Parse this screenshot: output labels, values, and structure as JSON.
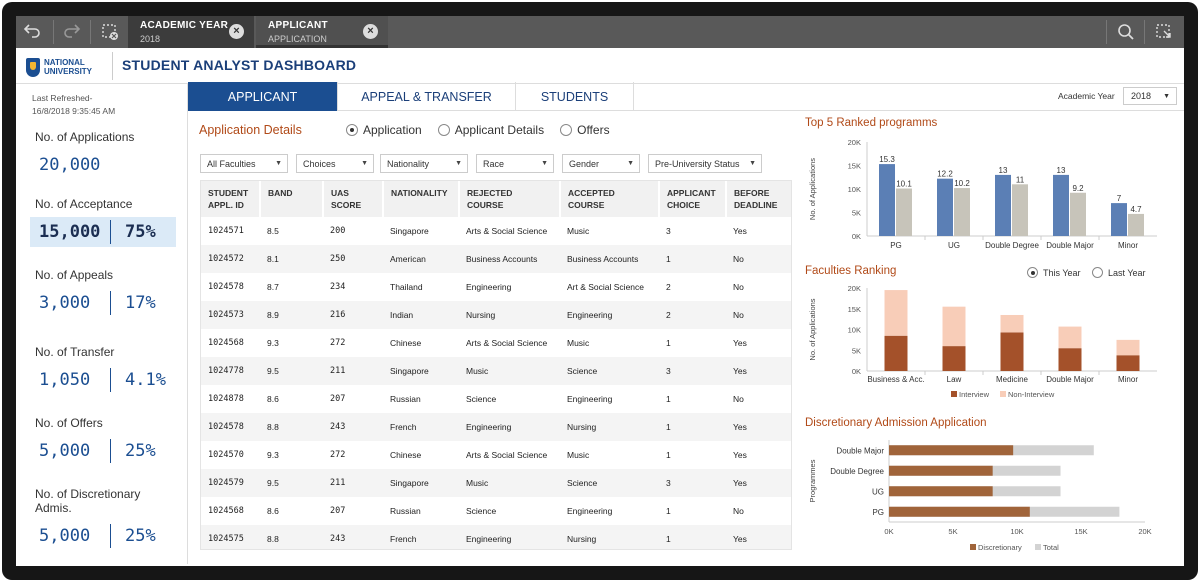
{
  "selections": {
    "chip1": {
      "title": "ACADEMIC YEAR",
      "value": "2018"
    },
    "chip2": {
      "title": "APPLICANT",
      "value": "APPLICATION"
    }
  },
  "header": {
    "logo_line1": "NATIONAL",
    "logo_line2": "UNIVERSITY",
    "title": "STUDENT ANALYST DASHBOARD"
  },
  "sidebar": {
    "refresh_label": "Last Refreshed-",
    "refresh_time": "16/8/2018 9:35:45 AM",
    "kpis": [
      {
        "label": "No. of Applications",
        "value": "20,000",
        "pct": ""
      },
      {
        "label": "No. of Acceptance",
        "value": "15,000",
        "pct": "75%"
      },
      {
        "label": "No. of Appeals",
        "value": "3,000",
        "pct": "17%"
      },
      {
        "label": "No. of Transfer",
        "value": "1,050",
        "pct": "4.1%"
      },
      {
        "label": "No. of Offers",
        "value": "5,000",
        "pct": "25%"
      },
      {
        "label": "No. of Discretionary Admis.",
        "value": "5,000",
        "pct": "25%"
      }
    ]
  },
  "tabs": [
    {
      "label": "APPLICANT",
      "active": true
    },
    {
      "label": "APPEAL & TRANSFER",
      "active": false
    },
    {
      "label": "STUDENTS",
      "active": false
    }
  ],
  "academic_year": {
    "label": "Academic Year",
    "value": "2018"
  },
  "details": {
    "title": "Application Details",
    "radios": [
      "Application",
      "Applicant Details",
      "Offers"
    ],
    "selected_radio": "Application",
    "filters": [
      "All Faculties",
      "Choices",
      "Nationality",
      "Race",
      "Gender",
      "Pre-University Status"
    ]
  },
  "table": {
    "headers": [
      [
        "STUDENT",
        "APPL. ID"
      ],
      [
        "BAND",
        ""
      ],
      [
        "UAS",
        "SCORE"
      ],
      [
        "NATIONALITY",
        ""
      ],
      [
        "REJECTED",
        "COURSE"
      ],
      [
        "ACCEPTED",
        "COURSE"
      ],
      [
        "APPLICANT",
        "CHOICE"
      ],
      [
        "BEFORE",
        "DEADLINE"
      ]
    ],
    "rows": [
      [
        "1024571",
        "8.5",
        "200",
        "Singapore",
        "Arts & Social Science",
        "Music",
        "3",
        "Yes"
      ],
      [
        "1024572",
        "8.1",
        "250",
        "American",
        "Business Accounts",
        "Business Accounts",
        "1",
        "No"
      ],
      [
        "1024578",
        "8.7",
        "234",
        "Thailand",
        "Engineering",
        "Art & Social Science",
        "2",
        "No"
      ],
      [
        "1024573",
        "8.9",
        "216",
        "Indian",
        "Nursing",
        "Engineering",
        "2",
        "No"
      ],
      [
        "1024568",
        "9.3",
        "272",
        "Chinese",
        "Arts & Social Science",
        "Music",
        "1",
        "Yes"
      ],
      [
        "1024778",
        "9.5",
        "211",
        "Singapore",
        "Music",
        "Science",
        "3",
        "Yes"
      ],
      [
        "1024878",
        "8.6",
        "207",
        "Russian",
        "Science",
        "Engineering",
        "1",
        "No"
      ],
      [
        "1024578",
        "8.8",
        "243",
        "French",
        "Engineering",
        "Nursing",
        "1",
        "Yes"
      ],
      [
        "1024570",
        "9.3",
        "272",
        "Chinese",
        "Arts & Social Science",
        "Music",
        "1",
        "Yes"
      ],
      [
        "1024579",
        "9.5",
        "211",
        "Singapore",
        "Music",
        "Science",
        "3",
        "Yes"
      ],
      [
        "1024568",
        "8.6",
        "207",
        "Russian",
        "Science",
        "Engineering",
        "1",
        "No"
      ],
      [
        "1024575",
        "8.8",
        "243",
        "French",
        "Engineering",
        "Nursing",
        "1",
        "Yes"
      ]
    ]
  },
  "faculties_radios": [
    "This Year",
    "Last Year"
  ],
  "colors": {
    "primary": "#1b4e91",
    "accent_title": "#b14a18",
    "this_year": "#5b7fb5",
    "last_year": "#c7c4ba",
    "interview": "#a4512a",
    "non_interview": "#f8cdb8",
    "discretionary": "#a0643a",
    "total": "#d3d3d3"
  },
  "chart_data": [
    {
      "type": "bar",
      "title": "Top 5 Ranked programms",
      "ylabel": "No. of Applications",
      "categories": [
        "PG",
        "UG",
        "Double Degree",
        "Double Major",
        "Minor"
      ],
      "series": [
        {
          "name": "This Year",
          "values": [
            15.3,
            12.2,
            13,
            13,
            7
          ]
        },
        {
          "name": "Last Year",
          "values": [
            10.1,
            10.2,
            11,
            9.2,
            4.7
          ]
        }
      ],
      "labels": [
        [
          "15.3",
          "10.1"
        ],
        [
          "12.2",
          "10.2"
        ],
        [
          "13",
          "11"
        ],
        [
          "13",
          "9.2"
        ],
        [
          "7",
          "4.7"
        ]
      ],
      "yticks": [
        "0K",
        "5K",
        "10K",
        "15K",
        "20K"
      ],
      "ylim": [
        0,
        20
      ],
      "legend": "bottom"
    },
    {
      "type": "bar",
      "title": "Faculties Ranking",
      "ylabel": "No. of Applications",
      "stacked": true,
      "categories": [
        "Business & Acc.",
        "Law",
        "Medicine",
        "Double Major",
        "Minor"
      ],
      "series": [
        {
          "name": "Interview",
          "values": [
            8.5,
            6,
            9.3,
            5.5,
            3.8
          ]
        },
        {
          "name": "Non-Interview",
          "values": [
            11,
            9.5,
            4.2,
            5.2,
            3.7
          ]
        }
      ],
      "yticks": [
        "0K",
        "5K",
        "10K",
        "15K",
        "20K"
      ],
      "ylim": [
        0,
        20
      ],
      "legend": "bottom"
    },
    {
      "type": "bar",
      "orientation": "horizontal",
      "title": "Discretionary Admission Application",
      "ylabel": "Programmes",
      "categories": [
        "Double Major",
        "Double Degree",
        "UG",
        "PG"
      ],
      "series": [
        {
          "name": "Discretionary",
          "values": [
            9.7,
            8.1,
            8.1,
            11
          ]
        },
        {
          "name": "Total",
          "values": [
            16,
            13.4,
            13.4,
            18
          ]
        }
      ],
      "xticks": [
        "0K",
        "5K",
        "10K",
        "15K",
        "20K"
      ],
      "xlim": [
        0,
        20
      ],
      "legend": "bottom"
    }
  ]
}
